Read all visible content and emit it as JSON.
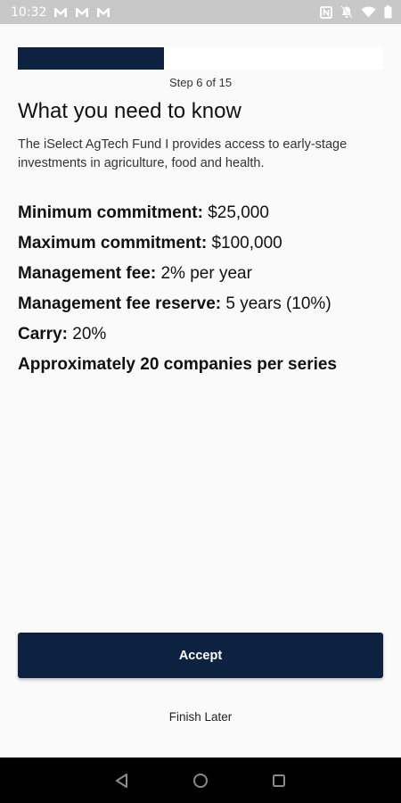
{
  "status_bar": {
    "time": "10:32"
  },
  "onboarding": {
    "progress_fraction": 0.4,
    "step_text": "Step 6 of 15",
    "title": "What you need to know",
    "intro": "The iSelect AgTech Fund I provides access to early-stage investments in agriculture, food and health.",
    "facts": [
      {
        "label": "Minimum commitment:",
        "value": " $25,000"
      },
      {
        "label": "Maximum commitment:",
        "value": " $100,000"
      },
      {
        "label": "Management fee:",
        "value": " 2% per year"
      },
      {
        "label": "Management fee reserve:",
        "value": " 5 years (10%)"
      },
      {
        "label": "Carry:",
        "value": " 20%"
      },
      {
        "label": "Approximately 20 companies per series",
        "value": ""
      }
    ],
    "accept_label": "Accept",
    "finish_later_label": "Finish Later"
  },
  "colors": {
    "primary": "#0d2240",
    "status_bar": "#c8c8c8",
    "background": "#fafafa"
  },
  "icons": {
    "status_left": [
      "gmail-icon",
      "gmail-icon",
      "gmail-icon"
    ],
    "status_right": [
      "nfc-icon",
      "mute-icon",
      "wifi-icon",
      "battery-icon"
    ],
    "nav": [
      "back-icon",
      "home-icon",
      "recents-icon"
    ]
  }
}
